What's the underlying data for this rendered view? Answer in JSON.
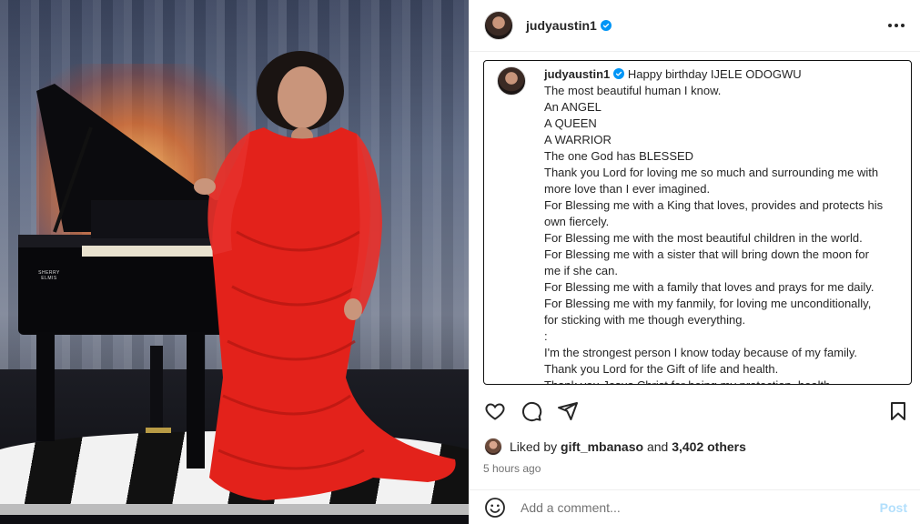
{
  "post": {
    "author": "judyaustin1",
    "verified": true,
    "photo_watermark": "SHERRY ELMIS"
  },
  "caption": {
    "username": "judyaustin1",
    "first_line": "Happy birthday IJELE ODOGWU",
    "lines": [
      "The most beautiful human I know.",
      "An ANGEL",
      "A QUEEN",
      "A WARRIOR",
      "The one God has BLESSED",
      "Thank you Lord for loving me so much and surrounding me with",
      "more love than I ever imagined.",
      "For Blessing me with a King that loves, provides and protects his",
      "own fiercely.",
      "For Blessing me with the most beautiful children in the world.",
      "For Blessing me with a sister that will bring down the moon for",
      "me if she can.",
      "For Blessing me with a family that loves and prays for me daily.",
      "For Blessing me with my fanmily, for loving me unconditionally,",
      "for sticking with me though everything.",
      ":",
      "I'm the strongest person I know today because of my family.",
      "Thank you Lord for the Gift of life and health.",
      "Thank you Jesus Christ for being my protection, health,"
    ]
  },
  "likes": {
    "prefix": "Liked by",
    "user": "gift_mbanaso",
    "connector": "and",
    "others": "3,402 others"
  },
  "timestamp": "5 hours ago",
  "comment": {
    "placeholder": "Add a comment...",
    "post_label": "Post"
  },
  "colors": {
    "verified": "#0095f6",
    "post_disabled": "#b2dffc",
    "dress": "#e3221b"
  },
  "icons": {
    "more": "more-horizontal-icon",
    "like": "heart-icon",
    "comment": "comment-icon",
    "share": "share-icon",
    "save": "bookmark-icon",
    "emoji": "emoji-icon"
  }
}
